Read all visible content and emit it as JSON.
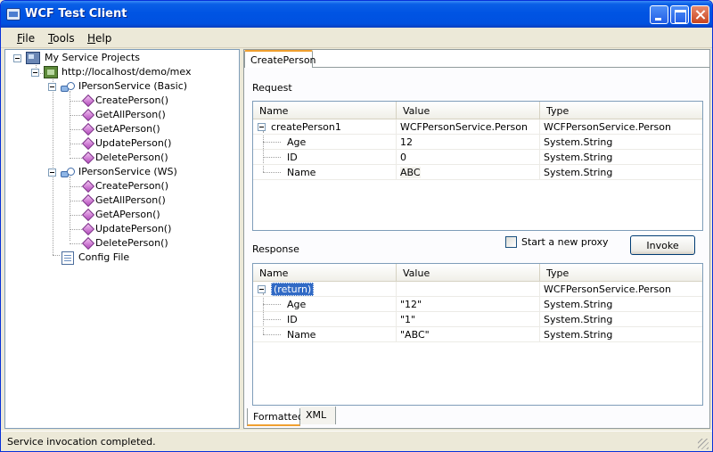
{
  "window": {
    "title": "WCF Test Client"
  },
  "menu": [
    {
      "key": "F",
      "rest": "ile"
    },
    {
      "key": "T",
      "rest": "ools"
    },
    {
      "key": "H",
      "rest": "elp"
    }
  ],
  "tree": {
    "root": "My Service Projects",
    "endpoint": "http://localhost/demo/mex",
    "contracts": [
      {
        "label": "IPersonService (Basic)",
        "ops": [
          "CreatePerson()",
          "GetAllPerson()",
          "GetAPerson()",
          "UpdatePerson()",
          "DeletePerson()"
        ]
      },
      {
        "label": "IPersonService (WS)",
        "ops": [
          "CreatePerson()",
          "GetAllPerson()",
          "GetAPerson()",
          "UpdatePerson()",
          "DeletePerson()"
        ]
      }
    ],
    "config": "Config File"
  },
  "tab": {
    "label": "CreatePerson"
  },
  "request": {
    "label": "Request",
    "columns": [
      "Name",
      "Value",
      "Type"
    ],
    "rows": [
      {
        "name": "createPerson1",
        "value": "WCFPersonService.Person",
        "type": "WCFPersonService.Person"
      },
      {
        "name": "Age",
        "value": "12",
        "type": "System.String"
      },
      {
        "name": "ID",
        "value": "0",
        "type": "System.String"
      },
      {
        "name": "Name",
        "value": "ABC",
        "type": "System.String"
      }
    ]
  },
  "proxy_checkbox": {
    "label": "Start a new proxy",
    "checked": false
  },
  "invoke_button": {
    "label": "Invoke"
  },
  "response": {
    "label": "Response",
    "columns": [
      "Name",
      "Value",
      "Type"
    ],
    "rows": [
      {
        "name": "(return)",
        "value": "",
        "type": "WCFPersonService.Person"
      },
      {
        "name": "Age",
        "value": "\"12\"",
        "type": "System.String"
      },
      {
        "name": "ID",
        "value": "\"1\"",
        "type": "System.String"
      },
      {
        "name": "Name",
        "value": "\"ABC\"",
        "type": "System.String"
      }
    ]
  },
  "bottom_tabs": [
    "Formatted",
    "XML"
  ],
  "status": {
    "text": "Service invocation completed."
  }
}
